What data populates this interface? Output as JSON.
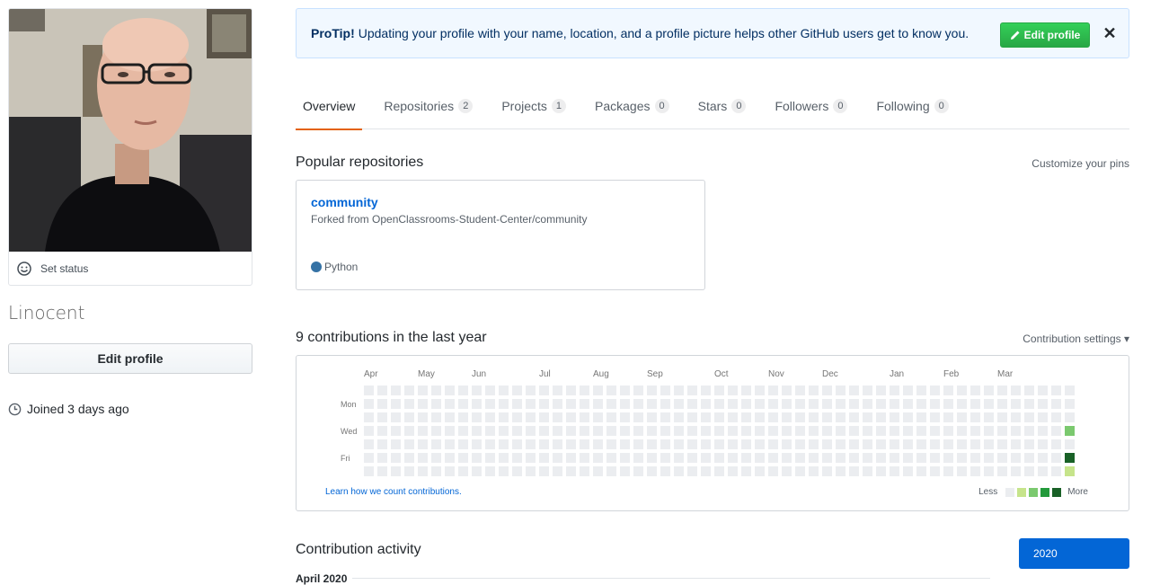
{
  "sidebar": {
    "set_status_label": "Set status",
    "username": "Linocent",
    "edit_profile_label": "Edit profile",
    "joined_label": "Joined 3 days ago"
  },
  "protip": {
    "lead": "ProTip!",
    "text": "Updating your profile with your name, location, and a profile picture helps other GitHub users get to know you.",
    "edit_button_label": "Edit profile",
    "close_glyph": "✕"
  },
  "tabs": [
    {
      "label": "Overview",
      "count": null,
      "active": true
    },
    {
      "label": "Repositories",
      "count": "2"
    },
    {
      "label": "Projects",
      "count": "1"
    },
    {
      "label": "Packages",
      "count": "0"
    },
    {
      "label": "Stars",
      "count": "0"
    },
    {
      "label": "Followers",
      "count": "0"
    },
    {
      "label": "Following",
      "count": "0"
    }
  ],
  "popular": {
    "title": "Popular repositories",
    "customize_label": "Customize your pins",
    "repos": [
      {
        "name": "community",
        "fork_text": "Forked from OpenClassrooms-Student-Center/community",
        "language": "Python",
        "language_color": "#3572A5"
      }
    ]
  },
  "contributions": {
    "title": "9 contributions in the last year",
    "settings_label": "Contribution settings ▾",
    "months": [
      "Apr",
      "May",
      "Jun",
      "Jul",
      "Aug",
      "Sep",
      "Oct",
      "Nov",
      "Dec",
      "Jan",
      "Feb",
      "Mar"
    ],
    "day_labels": [
      "Mon",
      "Wed",
      "Fri"
    ],
    "learn_link": "Learn how we count contributions.",
    "legend_less": "Less",
    "legend_more": "More",
    "colors": [
      "#ebedf0",
      "#c6e48b",
      "#7bc96f",
      "#239a3b",
      "#196127"
    ],
    "week_count": 53,
    "nonzero_days": [
      {
        "week": 52,
        "day": 3,
        "level": 2
      },
      {
        "week": 52,
        "day": 5,
        "level": 4
      },
      {
        "week": 52,
        "day": 6,
        "level": 1
      }
    ]
  },
  "activity": {
    "title": "Contribution activity",
    "year_button": "2020",
    "month_label": "April 2020"
  }
}
